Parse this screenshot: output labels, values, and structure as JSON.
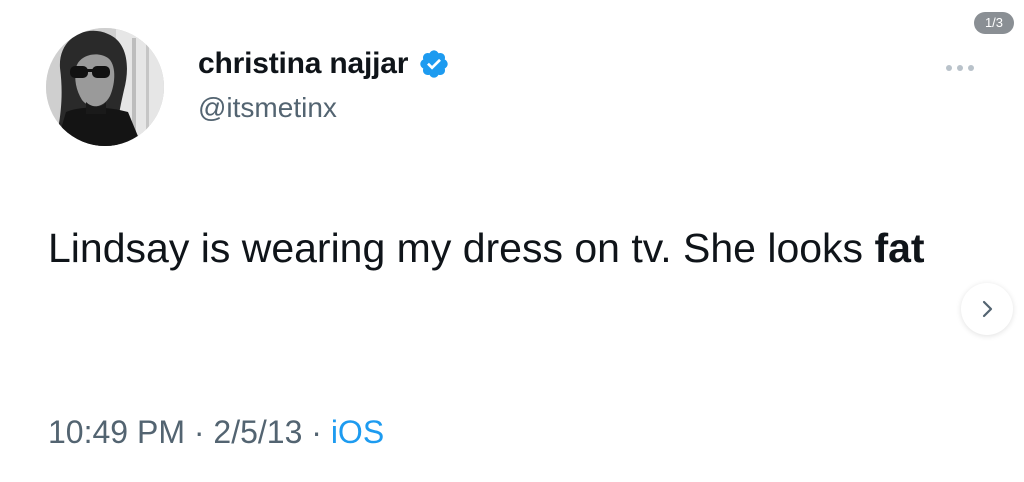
{
  "user": {
    "display_name": "christina najjar",
    "handle": "@itsmetinx",
    "verified_icon": "verified-badge-icon"
  },
  "gallery": {
    "counter": "1/3"
  },
  "tweet": {
    "text_before": "Lindsay is wearing my dress on tv. She looks ",
    "text_bold": "fat"
  },
  "meta": {
    "time": "10:49 PM",
    "separator_1": " · ",
    "date": "2/5/13",
    "separator_2": " · ",
    "source": "iOS"
  },
  "colors": {
    "verified_blue": "#1d9bf0",
    "text_primary": "#0f1419",
    "text_secondary": "#536471",
    "link_blue": "#1d9bf0"
  }
}
